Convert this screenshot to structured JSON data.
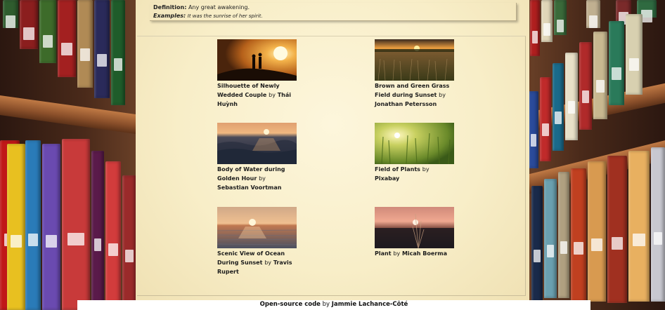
{
  "definition": {
    "label": "Definition:",
    "text": "Any great awakening.",
    "examples_label": "Examples:",
    "examples_text": "It was the sunrise of her spirit."
  },
  "gallery": {
    "items": [
      {
        "title": "Silhouette of Newly Wedded Couple",
        "by": "by",
        "author": "Thái Huỳnh",
        "image": "couple-silhouette-sunset"
      },
      {
        "title": "Brown and Green Grass Field during Sunset",
        "by": "by",
        "author": "Jonathan Petersson",
        "image": "grass-field-sunset"
      },
      {
        "title": "Body of Water during Golden Hour",
        "by": "by",
        "author": "Sebastian Voortman",
        "image": "ocean-golden-hour"
      },
      {
        "title": "Field of Plants",
        "by": "by",
        "author": "Pixabay",
        "image": "wheat-field-sunlight"
      },
      {
        "title": "Scenic View of Ocean During Sunset",
        "by": "by",
        "author": "Travis Rupert",
        "image": "ocean-sunset"
      },
      {
        "title": "Plant",
        "by": "by",
        "author": "Micah Boerma",
        "image": "plant-sunset"
      }
    ]
  },
  "footer": {
    "link_text": "Open-source code",
    "by": "by",
    "author": "Jammie Lachance-Côté"
  }
}
